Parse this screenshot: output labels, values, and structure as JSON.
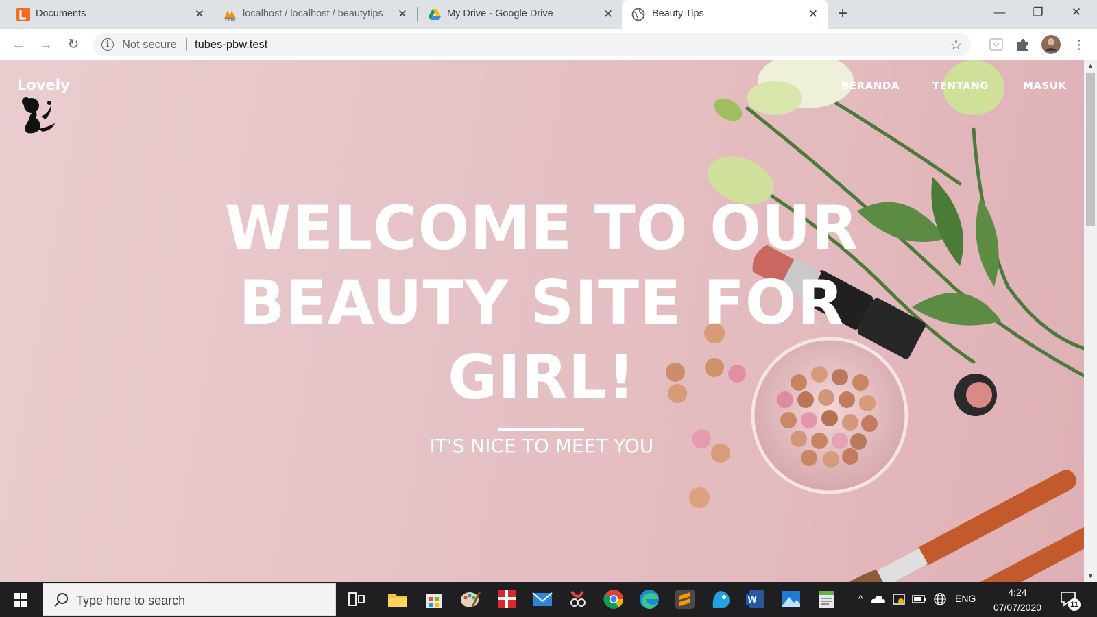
{
  "browser": {
    "tabs": [
      {
        "title": "Documents",
        "favicon": "documents-icon"
      },
      {
        "title": "localhost / localhost / beautytips",
        "favicon": "phpmyadmin-icon"
      },
      {
        "title": "My Drive - Google Drive",
        "favicon": "google-drive-icon"
      },
      {
        "title": "Beauty Tips",
        "favicon": "globe-icon",
        "active": true
      }
    ],
    "security_label": "Not secure",
    "url": "tubes-pbw.test"
  },
  "site": {
    "logo_text": "Lovely",
    "nav": [
      "BERANDA",
      "TENTANG",
      "MASUK"
    ],
    "hero_line1": "WELCOME TO OUR",
    "hero_line2": "BEAUTY SITE FOR",
    "hero_line3": "GIRL!",
    "hero_subtitle": "IT'S NICE TO MEET YOU"
  },
  "taskbar": {
    "search_placeholder": "Type here to search",
    "language": "ENG",
    "time": "4:24",
    "date": "07/07/2020",
    "notification_count": "11",
    "apps": [
      "task-view-icon",
      "file-explorer-icon",
      "microsoft-store-icon",
      "paint-icon",
      "gift-app-icon",
      "mail-icon",
      "snip-sketch-icon",
      "chrome-icon",
      "edge-icon",
      "sublime-text-icon",
      "app-icon",
      "word-icon",
      "photos-icon",
      "notepad-app-icon"
    ]
  },
  "colors": {
    "hero_bg": "#e5c3c6",
    "taskbar_bg": "#1f1f22",
    "tabstrip_bg": "#dee1e6"
  }
}
